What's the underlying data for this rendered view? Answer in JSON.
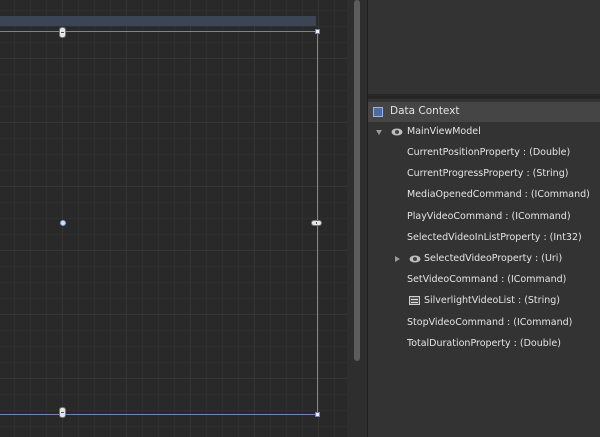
{
  "data_context": {
    "header": "Data Context",
    "root": {
      "label": "MainViewModel",
      "expanded": true,
      "icon": "eye-icon"
    },
    "properties": [
      {
        "label": "CurrentPositionProperty : (Double)",
        "icon": "",
        "expandable": false
      },
      {
        "label": "CurrentProgressProperty : (String)",
        "icon": "",
        "expandable": false
      },
      {
        "label": "MediaOpenedCommand : (ICommand)",
        "icon": "",
        "expandable": false
      },
      {
        "label": "PlayVideoCommand : (ICommand)",
        "icon": "",
        "expandable": false
      },
      {
        "label": "SelectedVideoInListProperty : (Int32)",
        "icon": "",
        "expandable": false
      },
      {
        "label": "SelectedVideoProperty : (Uri)",
        "icon": "eye-icon",
        "expandable": true
      },
      {
        "label": "SetVideoCommand : (ICommand)",
        "icon": "",
        "expandable": false
      },
      {
        "label": "SilverlightVideoList : (String)",
        "icon": "list-icon",
        "expandable": false
      },
      {
        "label": "StopVideoCommand : (ICommand)",
        "icon": "",
        "expandable": false
      },
      {
        "label": "TotalDurationProperty : (Double)",
        "icon": "",
        "expandable": false
      }
    ]
  },
  "colors": {
    "canvas_bg": "#292929",
    "panel_bg": "#333333",
    "selection": "#6f86b5",
    "text": "#e4e4e4"
  }
}
